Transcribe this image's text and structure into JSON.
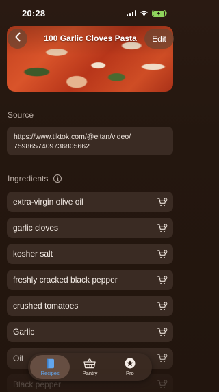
{
  "status_bar": {
    "time": "20:28"
  },
  "header": {
    "title": "100 Garlic Cloves Pasta",
    "edit_label": "Edit"
  },
  "source": {
    "label": "Source",
    "url_line1": "https://www.tiktok.com/@eitan/video/",
    "url_line2": "7598657409736805662"
  },
  "ingredients": {
    "label": "Ingredients",
    "items": [
      "extra-virgin olive oil",
      "garlic cloves",
      "kosher salt",
      "freshly cracked black pepper",
      "crushed tomatoes",
      "Garlic",
      "Oil",
      "Black pepper"
    ]
  },
  "tabbar": {
    "tabs": [
      {
        "label": "Recipes",
        "icon": "book-icon",
        "active": true
      },
      {
        "label": "Pantry",
        "icon": "basket-icon",
        "active": false
      },
      {
        "label": "Pro",
        "icon": "star-badge-icon",
        "active": false
      }
    ],
    "accent": "#62a6ee"
  }
}
